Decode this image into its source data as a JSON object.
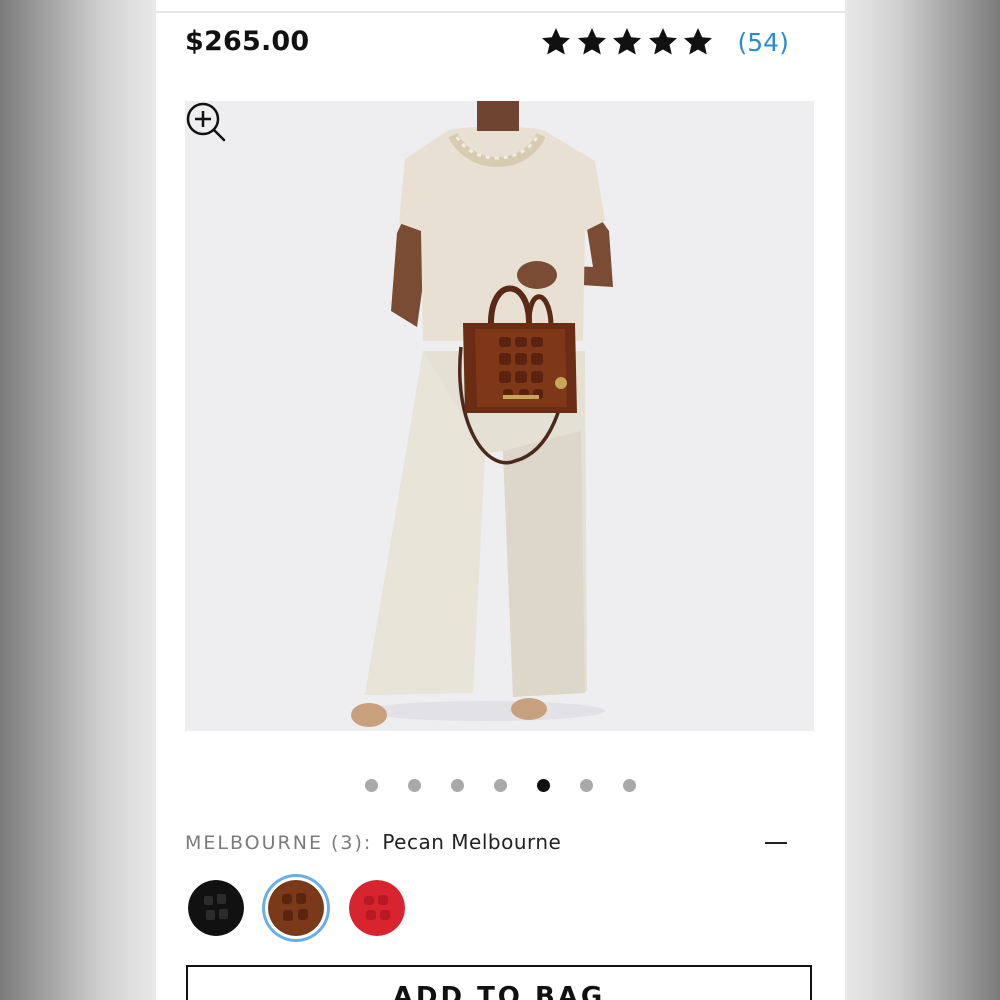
{
  "product": {
    "price": "$265.00",
    "rating": {
      "stars": 5,
      "review_count": "(54)"
    }
  },
  "gallery": {
    "image_count": 7,
    "active_index": 4,
    "zoom_icon": "zoom-in-icon"
  },
  "color_selector": {
    "label": "MELBOURNE (3):",
    "selected_name": "Pecan Melbourne",
    "collapse_icon": "minus-icon",
    "swatches": [
      {
        "name": "black",
        "color": "#111111",
        "selected": false
      },
      {
        "name": "pecan",
        "color": "#7a3a1a",
        "selected": true
      },
      {
        "name": "red",
        "color": "#d8242e",
        "selected": false
      }
    ]
  },
  "cta": {
    "add_to_bag_label": "ADD TO BAG"
  },
  "colors": {
    "review_link": "#2a8ad6",
    "active_dot": "#111111",
    "inactive_dot": "#a9a9a9",
    "swatch_ring": "#6ab0e8"
  }
}
